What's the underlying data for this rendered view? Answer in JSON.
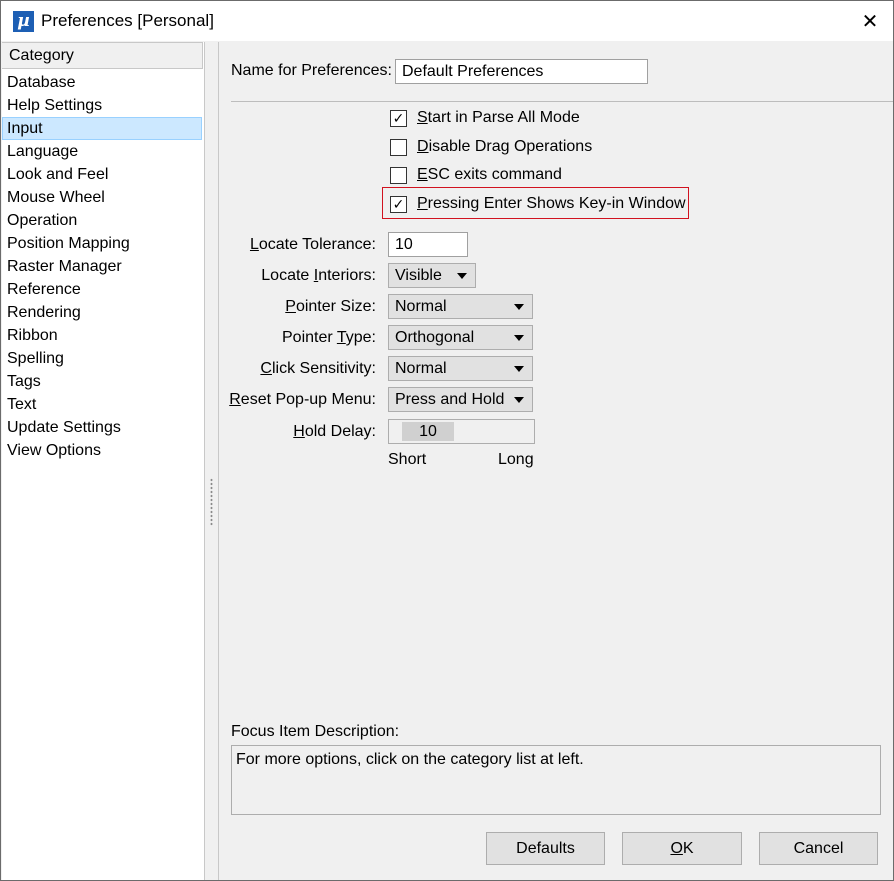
{
  "window": {
    "title": "Preferences [Personal]",
    "app_icon_glyph": "µ",
    "close_glyph": "✕"
  },
  "sidebar": {
    "header": "Category",
    "items": [
      {
        "label": "Database"
      },
      {
        "label": "Help Settings"
      },
      {
        "label": "Input",
        "selected": true
      },
      {
        "label": "Language"
      },
      {
        "label": "Look and Feel"
      },
      {
        "label": "Mouse Wheel"
      },
      {
        "label": "Operation"
      },
      {
        "label": "Position Mapping"
      },
      {
        "label": "Raster Manager"
      },
      {
        "label": "Reference"
      },
      {
        "label": "Rendering"
      },
      {
        "label": "Ribbon"
      },
      {
        "label": "Spelling"
      },
      {
        "label": "Tags"
      },
      {
        "label": "Text"
      },
      {
        "label": "Update Settings"
      },
      {
        "label": "View Options"
      }
    ]
  },
  "main": {
    "name_label": "Name for Preferences:",
    "name_value": "Default Preferences",
    "checkboxes": [
      {
        "label_first": "S",
        "label_rest": "tart in Parse All Mode",
        "checked": true
      },
      {
        "label_first": "D",
        "label_rest": "isable Drag Operations",
        "checked": false
      },
      {
        "label_first": "E",
        "label_rest": "SC exits command",
        "checked": false
      },
      {
        "label_first": "P",
        "label_rest": "ressing Enter Shows Key-in Window",
        "checked": true
      }
    ],
    "check_glyph": "✓",
    "locate_tolerance": {
      "label_first": "L",
      "label_rest": "ocate Tolerance:",
      "value": "10"
    },
    "locate_interiors": {
      "label_pre": "Locate ",
      "label_u": "I",
      "label_post": "nteriors:",
      "value": "Visible"
    },
    "pointer_size": {
      "label_first": "P",
      "label_rest": "ointer Size:",
      "value": "Normal"
    },
    "pointer_type": {
      "label_pre": "Pointer ",
      "label_u": "T",
      "label_post": "ype:",
      "value": "Orthogonal"
    },
    "click_sensitivity": {
      "label_first": "C",
      "label_rest": "lick Sensitivity:",
      "value": "Normal"
    },
    "reset_popup": {
      "label_first": "R",
      "label_rest": "eset Pop-up Menu:",
      "value": "Press and Hold"
    },
    "hold_delay": {
      "label_first": "H",
      "label_rest": "old Delay:",
      "value": "10",
      "min_label": "Short",
      "max_label": "Long"
    },
    "focus_label": "Focus Item Description:",
    "focus_text": "For more options, click on the category list at left."
  },
  "buttons": {
    "defaults": "Defaults",
    "ok_first": "O",
    "ok_rest": "K",
    "cancel": "Cancel"
  }
}
